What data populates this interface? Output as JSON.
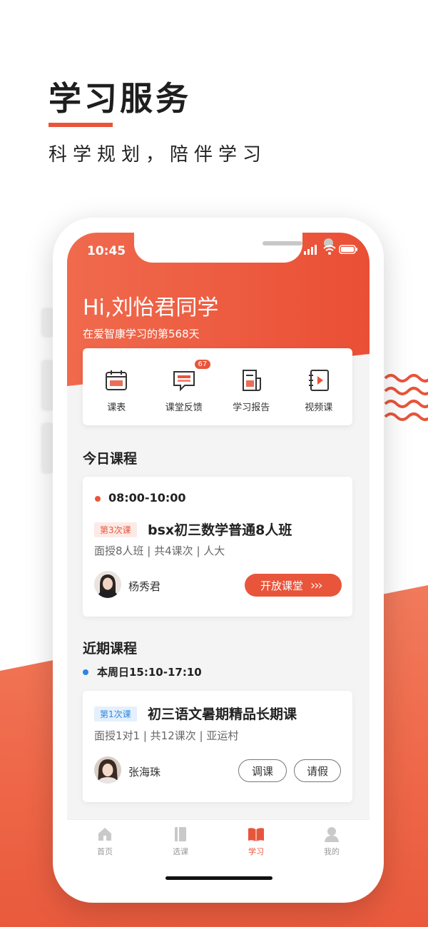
{
  "promo": {
    "title": "学习服务",
    "subtitle": "科学规划，陪伴学习"
  },
  "status_bar": {
    "time": "10:45"
  },
  "header": {
    "greeting": "Hi,刘怡君同学",
    "days_text": "在爱智康学习的第568天"
  },
  "quick_actions": [
    {
      "label": "课表",
      "icon": "calendar-icon"
    },
    {
      "label": "课堂反馈",
      "icon": "feedback-icon",
      "badge": "67"
    },
    {
      "label": "学习报告",
      "icon": "report-icon"
    },
    {
      "label": "视频课",
      "icon": "video-icon"
    }
  ],
  "today": {
    "section_title": "今日课程",
    "time": "08:00-10:00",
    "lesson_tag": "第3次课",
    "course_name": "bsx初三数学普通8人班",
    "meta": "面授8人班 | 共4课次 | 人大",
    "teacher": "杨秀君",
    "enter_button": "开放课堂",
    "arrows": "›››"
  },
  "upcoming": {
    "section_title": "近期课程",
    "date_time": "本周日15:10-17:10",
    "lesson_tag": "第1次课",
    "course_name": "初三语文暑期精品长期课",
    "meta": "面授1对1 | 共12课次 | 亚运村",
    "teacher": "张海珠",
    "reschedule_button": "调课",
    "leave_button": "请假"
  },
  "tabs": [
    {
      "label": "首页",
      "icon": "home-icon"
    },
    {
      "label": "选课",
      "icon": "book-icon"
    },
    {
      "label": "学习",
      "icon": "open-book-icon",
      "active": true
    },
    {
      "label": "我的",
      "icon": "user-icon"
    }
  ],
  "colors": {
    "accent": "#e8553b",
    "blue_tag": "#2a86e0",
    "red_tag_bg": "#fdeae6",
    "blue_tag_bg": "#e4f0fc"
  }
}
